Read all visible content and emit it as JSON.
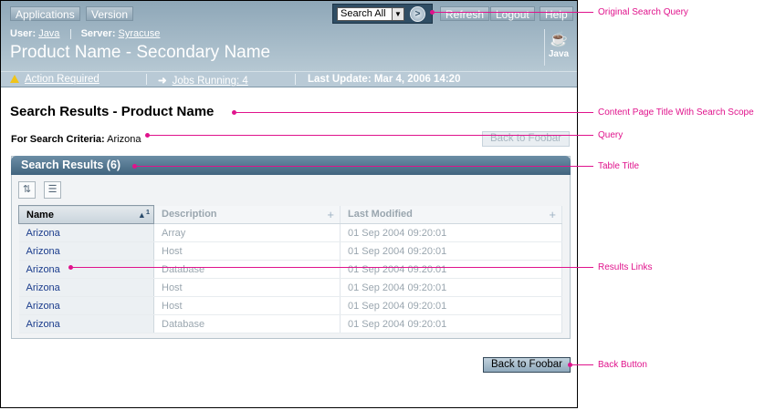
{
  "masthead": {
    "nav_buttons": [
      "Applications",
      "Version"
    ],
    "search": {
      "scope": "Search All",
      "go_glyph": ">"
    },
    "action_buttons": [
      "Refresh",
      "Logout",
      "Help"
    ],
    "user_label": "User:",
    "user_value": "Java",
    "server_label": "Server:",
    "server_value": "Syracuse",
    "product_name": "Product Name - Secondary Name",
    "logo_text": "Java"
  },
  "status": {
    "action_required": "Action Required",
    "jobs_running": "Jobs Running: 4",
    "last_update": "Last Update: Mar 4, 2006 14:20"
  },
  "content": {
    "page_title": "Search Results - Product Name",
    "criteria_label": "For Search Criteria:",
    "criteria_value": "Arizona",
    "top_button": "Back to Foobar",
    "bottom_button": "Back to Foobar"
  },
  "table": {
    "title": "Search Results (6)",
    "sort_badge": "1",
    "columns": [
      "Name",
      "Description",
      "Last Modified"
    ],
    "rows": [
      {
        "name": "Arizona",
        "description": "Array",
        "modified": "01 Sep 2004 09:20:01"
      },
      {
        "name": "Arizona",
        "description": "Host",
        "modified": "01 Sep 2004 09:20:01"
      },
      {
        "name": "Arizona",
        "description": "Database",
        "modified": "01 Sep 2004 09:20:01"
      },
      {
        "name": "Arizona",
        "description": "Host",
        "modified": "01 Sep 2004 09:20:01"
      },
      {
        "name": "Arizona",
        "description": "Host",
        "modified": "01 Sep 2004 09:20:01"
      },
      {
        "name": "Arizona",
        "description": "Database",
        "modified": "01 Sep 2004 09:20:01"
      }
    ]
  },
  "annotations": [
    "Original Search Query",
    "Content Page Title With Search Scope",
    "Query",
    "Table Title",
    "Results Links",
    "Back Button"
  ],
  "colors": {
    "accent": "#e0138c",
    "masthead": "#8ea7b8",
    "table_title": "#4f7189",
    "link": "#1a3c8c"
  }
}
